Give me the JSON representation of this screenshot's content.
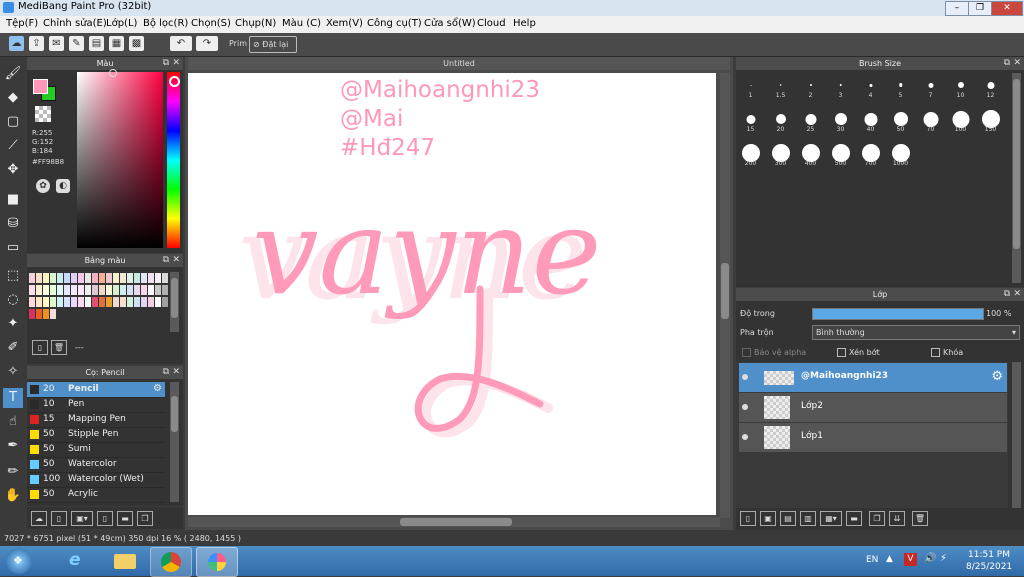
{
  "window": {
    "title": "MediBang Paint Pro (32bit)"
  },
  "menu": [
    "Tệp(F)",
    "Chỉnh sửa(E)",
    "Lớp(L)",
    "Bộ lọc(R)",
    "Chọn(S)",
    "Chụp(N)",
    "Màu (C)",
    "Xem(V)",
    "Công cụ(T)",
    "Cửa sổ(W)",
    "Cloud",
    "Help"
  ],
  "toolbar": {
    "prim_label": "Prim",
    "reset_label": "Đặt lại"
  },
  "color_panel": {
    "title": "Màu",
    "rgb": {
      "r": "R:255",
      "g": "G:152",
      "b": "B:184"
    },
    "hex": "#FF98B8",
    "foreground_color": "#FF98B8",
    "background_color": "#22CC22"
  },
  "palette_panel": {
    "title": "Bảng màu",
    "footer_label": "---",
    "swatches": [
      "#f6d0d8",
      "#f8e0c8",
      "#f8f4c0",
      "#d8f4c8",
      "#c8ecf0",
      "#c8d8f8",
      "#e0d0f8",
      "#f4c8e8",
      "#e8e8e8",
      "#f0b0c0",
      "#f4b090",
      "#f0c8d0",
      "#f4f0d0",
      "#f0e8d0",
      "#e0f0e8",
      "#c8e8e0",
      "#e0e8f8",
      "#f0e0f0",
      "#f8f0f8",
      "#d8d8d8",
      "#ffe0e8",
      "#fff0d8",
      "#ffffe0",
      "#e8ffe0",
      "#e0f8f8",
      "#e8e8ff",
      "#f0e8ff",
      "#ffe8f8",
      "#f0f0f0",
      "#e0c8d0",
      "#f0d8c8",
      "#f8f8d8",
      "#d8f0d0",
      "#d0f0f0",
      "#d8e0f8",
      "#e8d8f0",
      "#f8d8e8",
      "#fafafa",
      "#c8c8c8",
      "#b0b0b0",
      "#ffd8e0",
      "#ffe8c8",
      "#fff8c8",
      "#e0f8d0",
      "#d0f0f8",
      "#d8e0ff",
      "#e8d8ff",
      "#ffd8f0",
      "#f8f8f8",
      "#e05070",
      "#e07040",
      "#e8a030",
      "#f0d8d0",
      "#f8e0c8",
      "#d0f0e0",
      "#d0e0f0",
      "#e0d8f0",
      "#f0d0e0",
      "#ffffff",
      "#a0a0a0",
      "#d83060",
      "#e86020",
      "#f09020",
      "#f0e0d8"
    ]
  },
  "brush_panel": {
    "title": "Cọ: Pencil",
    "items": [
      {
        "size": "20",
        "name": "Pencil",
        "color": "#2a2a2a",
        "selected": true
      },
      {
        "size": "10",
        "name": "Pen",
        "color": "#2a2a2a"
      },
      {
        "size": "15",
        "name": "Mapping Pen",
        "color": "#dd2222"
      },
      {
        "size": "50",
        "name": "Stipple Pen",
        "color": "#ffdd00"
      },
      {
        "size": "50",
        "name": "Sumi",
        "color": "#ffdd00"
      },
      {
        "size": "50",
        "name": "Watercolor",
        "color": "#66ccff"
      },
      {
        "size": "100",
        "name": "Watercolor (Wet)",
        "color": "#66ccff"
      },
      {
        "size": "50",
        "name": "Acrylic",
        "color": "#ffdd00"
      }
    ]
  },
  "canvas": {
    "tab_title": "Untitled",
    "text_lines": [
      "@Maihoangnhi23",
      "@Mai",
      "#Hđ247"
    ],
    "lettering": "vayne"
  },
  "brush_size_panel": {
    "title": "Brush Size",
    "sizes": [
      "1",
      "1.5",
      "2",
      "3",
      "4",
      "5",
      "7",
      "10",
      "12",
      "15",
      "20",
      "25",
      "30",
      "40",
      "50",
      "70",
      "100",
      "150",
      "200",
      "300",
      "400",
      "500",
      "700",
      "1000"
    ]
  },
  "layer_panel": {
    "title": "Lớp",
    "opacity_label": "Độ trong",
    "opacity_value": "100 %",
    "opacity_fraction": 1.0,
    "blend_label": "Pha trộn",
    "blend_value": "Bình thường",
    "protect_alpha_label": "Bảo vệ alpha",
    "clip_label": "Xén bớt",
    "lock_label": "Khóa",
    "layers": [
      {
        "name": "@Maihoangnhi23",
        "selected": true
      },
      {
        "name": "Lớp2"
      },
      {
        "name": "Lớp1"
      }
    ]
  },
  "status_bar": {
    "text": "7027 * 6751 pixel   (51 * 49cm)   350 dpi   16 %   ( 2480, 1455 )"
  },
  "taskbar": {
    "language": "EN",
    "time": "11:51 PM",
    "date": "8/25/2021"
  }
}
